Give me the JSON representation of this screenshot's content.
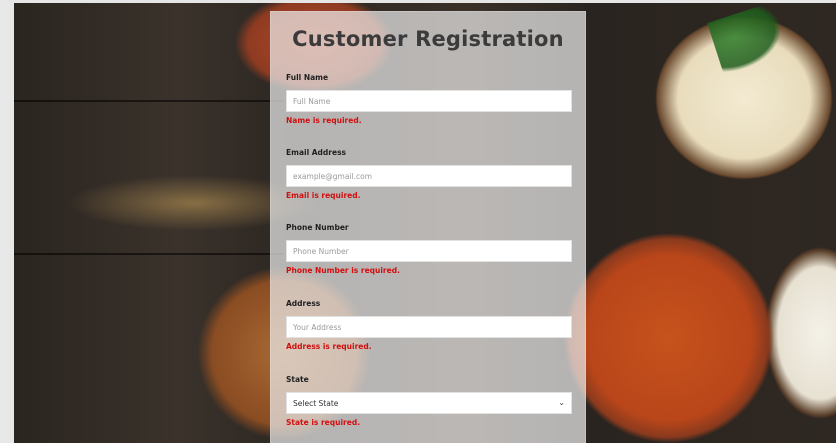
{
  "form": {
    "title": "Customer Registration",
    "fields": [
      {
        "label": "Full Name",
        "placeholder": "Full Name",
        "error": "Name is required."
      },
      {
        "label": "Email Address",
        "placeholder": "example@gmail.com",
        "error": "Email is required."
      },
      {
        "label": "Phone Number",
        "placeholder": "Phone Number",
        "error": "Phone Number is required."
      },
      {
        "label": "Address",
        "placeholder": "Your Address",
        "error": "Address is required."
      },
      {
        "label": "State",
        "selected": "Select State",
        "error": "State is required."
      }
    ]
  },
  "icons": {
    "select_chevron": "chevron-down-icon"
  },
  "colors": {
    "error": "#d10f0f",
    "title": "#3b3b3b",
    "panel": "rgba(235,235,235,0.72)"
  }
}
